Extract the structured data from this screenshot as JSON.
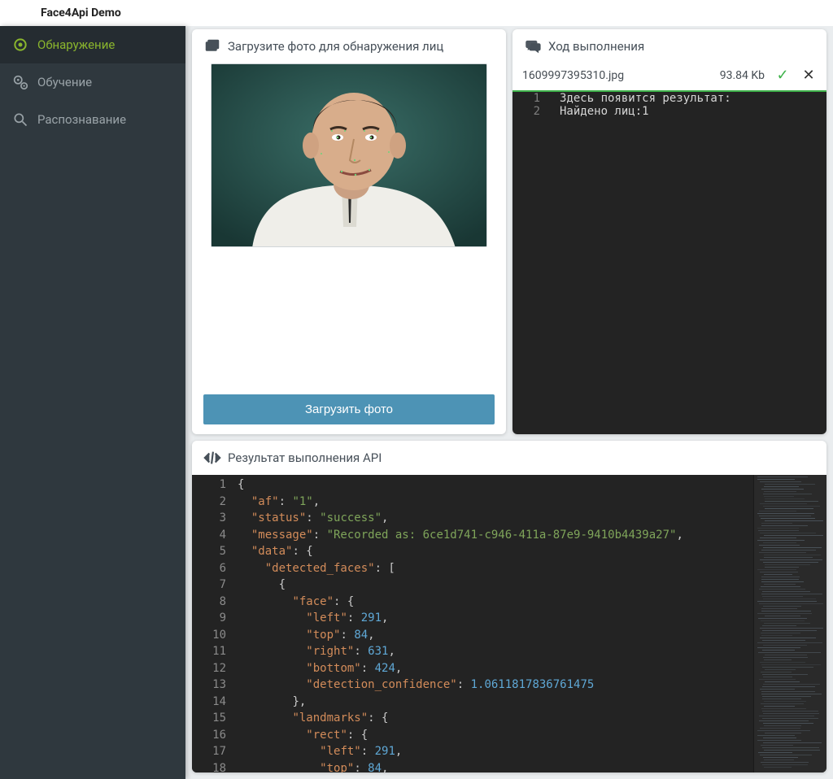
{
  "app_title": "Face4Api Demo",
  "sidebar": {
    "items": [
      {
        "label": "Обнаружение",
        "active": true
      },
      {
        "label": "Обучение",
        "active": false
      },
      {
        "label": "Распознавание",
        "active": false
      }
    ]
  },
  "upload_panel": {
    "title": "Загрузите фото для обнаружения лиц",
    "button_label": "Загрузить фото"
  },
  "progress_panel": {
    "title": "Ход выполнения",
    "file": {
      "name": "1609997395310.jpg",
      "size": "93.84 Kb"
    },
    "console_lines": [
      "Здесь появится результат:",
      "Найдено лиц:1"
    ]
  },
  "result_panel": {
    "title": "Результат выполнения API",
    "code_lines": [
      [
        {
          "t": "punc",
          "v": "{"
        }
      ],
      [
        {
          "t": "indent",
          "v": 1
        },
        {
          "t": "key",
          "v": "\"af\""
        },
        {
          "t": "punc",
          "v": ": "
        },
        {
          "t": "str",
          "v": "\"1\""
        },
        {
          "t": "punc",
          "v": ","
        }
      ],
      [
        {
          "t": "indent",
          "v": 1
        },
        {
          "t": "key",
          "v": "\"status\""
        },
        {
          "t": "punc",
          "v": ": "
        },
        {
          "t": "str",
          "v": "\"success\""
        },
        {
          "t": "punc",
          "v": ","
        }
      ],
      [
        {
          "t": "indent",
          "v": 1
        },
        {
          "t": "key",
          "v": "\"message\""
        },
        {
          "t": "punc",
          "v": ": "
        },
        {
          "t": "str",
          "v": "\"Recorded as: 6ce1d741-c946-411a-87e9-9410b4439a27\""
        },
        {
          "t": "punc",
          "v": ","
        }
      ],
      [
        {
          "t": "indent",
          "v": 1
        },
        {
          "t": "key",
          "v": "\"data\""
        },
        {
          "t": "punc",
          "v": ": {"
        }
      ],
      [
        {
          "t": "indent",
          "v": 2
        },
        {
          "t": "key",
          "v": "\"detected_faces\""
        },
        {
          "t": "punc",
          "v": ": ["
        }
      ],
      [
        {
          "t": "indent",
          "v": 3
        },
        {
          "t": "punc",
          "v": "{"
        }
      ],
      [
        {
          "t": "indent",
          "v": 4
        },
        {
          "t": "key",
          "v": "\"face\""
        },
        {
          "t": "punc",
          "v": ": {"
        }
      ],
      [
        {
          "t": "indent",
          "v": 5
        },
        {
          "t": "key",
          "v": "\"left\""
        },
        {
          "t": "punc",
          "v": ": "
        },
        {
          "t": "num",
          "v": "291"
        },
        {
          "t": "punc",
          "v": ","
        }
      ],
      [
        {
          "t": "indent",
          "v": 5
        },
        {
          "t": "key",
          "v": "\"top\""
        },
        {
          "t": "punc",
          "v": ": "
        },
        {
          "t": "num",
          "v": "84"
        },
        {
          "t": "punc",
          "v": ","
        }
      ],
      [
        {
          "t": "indent",
          "v": 5
        },
        {
          "t": "key",
          "v": "\"right\""
        },
        {
          "t": "punc",
          "v": ": "
        },
        {
          "t": "num",
          "v": "631"
        },
        {
          "t": "punc",
          "v": ","
        }
      ],
      [
        {
          "t": "indent",
          "v": 5
        },
        {
          "t": "key",
          "v": "\"bottom\""
        },
        {
          "t": "punc",
          "v": ": "
        },
        {
          "t": "num",
          "v": "424"
        },
        {
          "t": "punc",
          "v": ","
        }
      ],
      [
        {
          "t": "indent",
          "v": 5
        },
        {
          "t": "key",
          "v": "\"detection_confidence\""
        },
        {
          "t": "punc",
          "v": ": "
        },
        {
          "t": "num",
          "v": "1.0611817836761475"
        }
      ],
      [
        {
          "t": "indent",
          "v": 4
        },
        {
          "t": "punc",
          "v": "},"
        }
      ],
      [
        {
          "t": "indent",
          "v": 4
        },
        {
          "t": "key",
          "v": "\"landmarks\""
        },
        {
          "t": "punc",
          "v": ": {"
        }
      ],
      [
        {
          "t": "indent",
          "v": 5
        },
        {
          "t": "key",
          "v": "\"rect\""
        },
        {
          "t": "punc",
          "v": ": {"
        }
      ],
      [
        {
          "t": "indent",
          "v": 6
        },
        {
          "t": "key",
          "v": "\"left\""
        },
        {
          "t": "punc",
          "v": ": "
        },
        {
          "t": "num",
          "v": "291"
        },
        {
          "t": "punc",
          "v": ","
        }
      ],
      [
        {
          "t": "indent",
          "v": 6
        },
        {
          "t": "key",
          "v": "\"top\""
        },
        {
          "t": "punc",
          "v": ": "
        },
        {
          "t": "num",
          "v": "84"
        },
        {
          "t": "punc",
          "v": ","
        }
      ]
    ]
  }
}
